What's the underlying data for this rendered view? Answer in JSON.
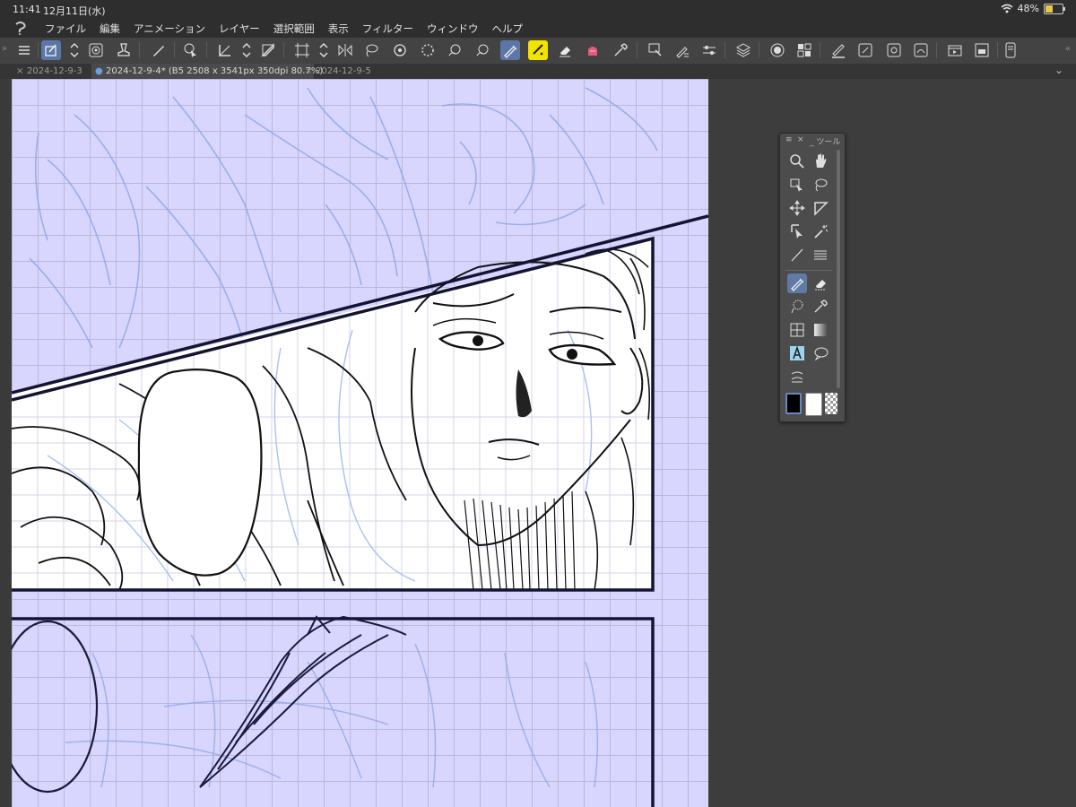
{
  "status": {
    "time": "11:41",
    "date": "12月11日(水)",
    "battery": "48%"
  },
  "menu": {
    "items": [
      "ファイル",
      "編集",
      "アニメーション",
      "レイヤー",
      "選択範囲",
      "表示",
      "フィルター",
      "ウィンドウ",
      "ヘルプ"
    ]
  },
  "tabs": [
    {
      "label": "2024-12-9-3"
    },
    {
      "label": "2024-12-9-4* (B5 2508 x 3541px 350dpi 80.7%)"
    },
    {
      "label": "2024-12-9-5"
    }
  ],
  "palette": {
    "title": "ツール"
  },
  "colors": {
    "accent": "#5c77a6",
    "canvas": "#d8d6ff",
    "sketch": "#8fa8e8",
    "ink": "#111111",
    "highlight": "#f2e300"
  }
}
